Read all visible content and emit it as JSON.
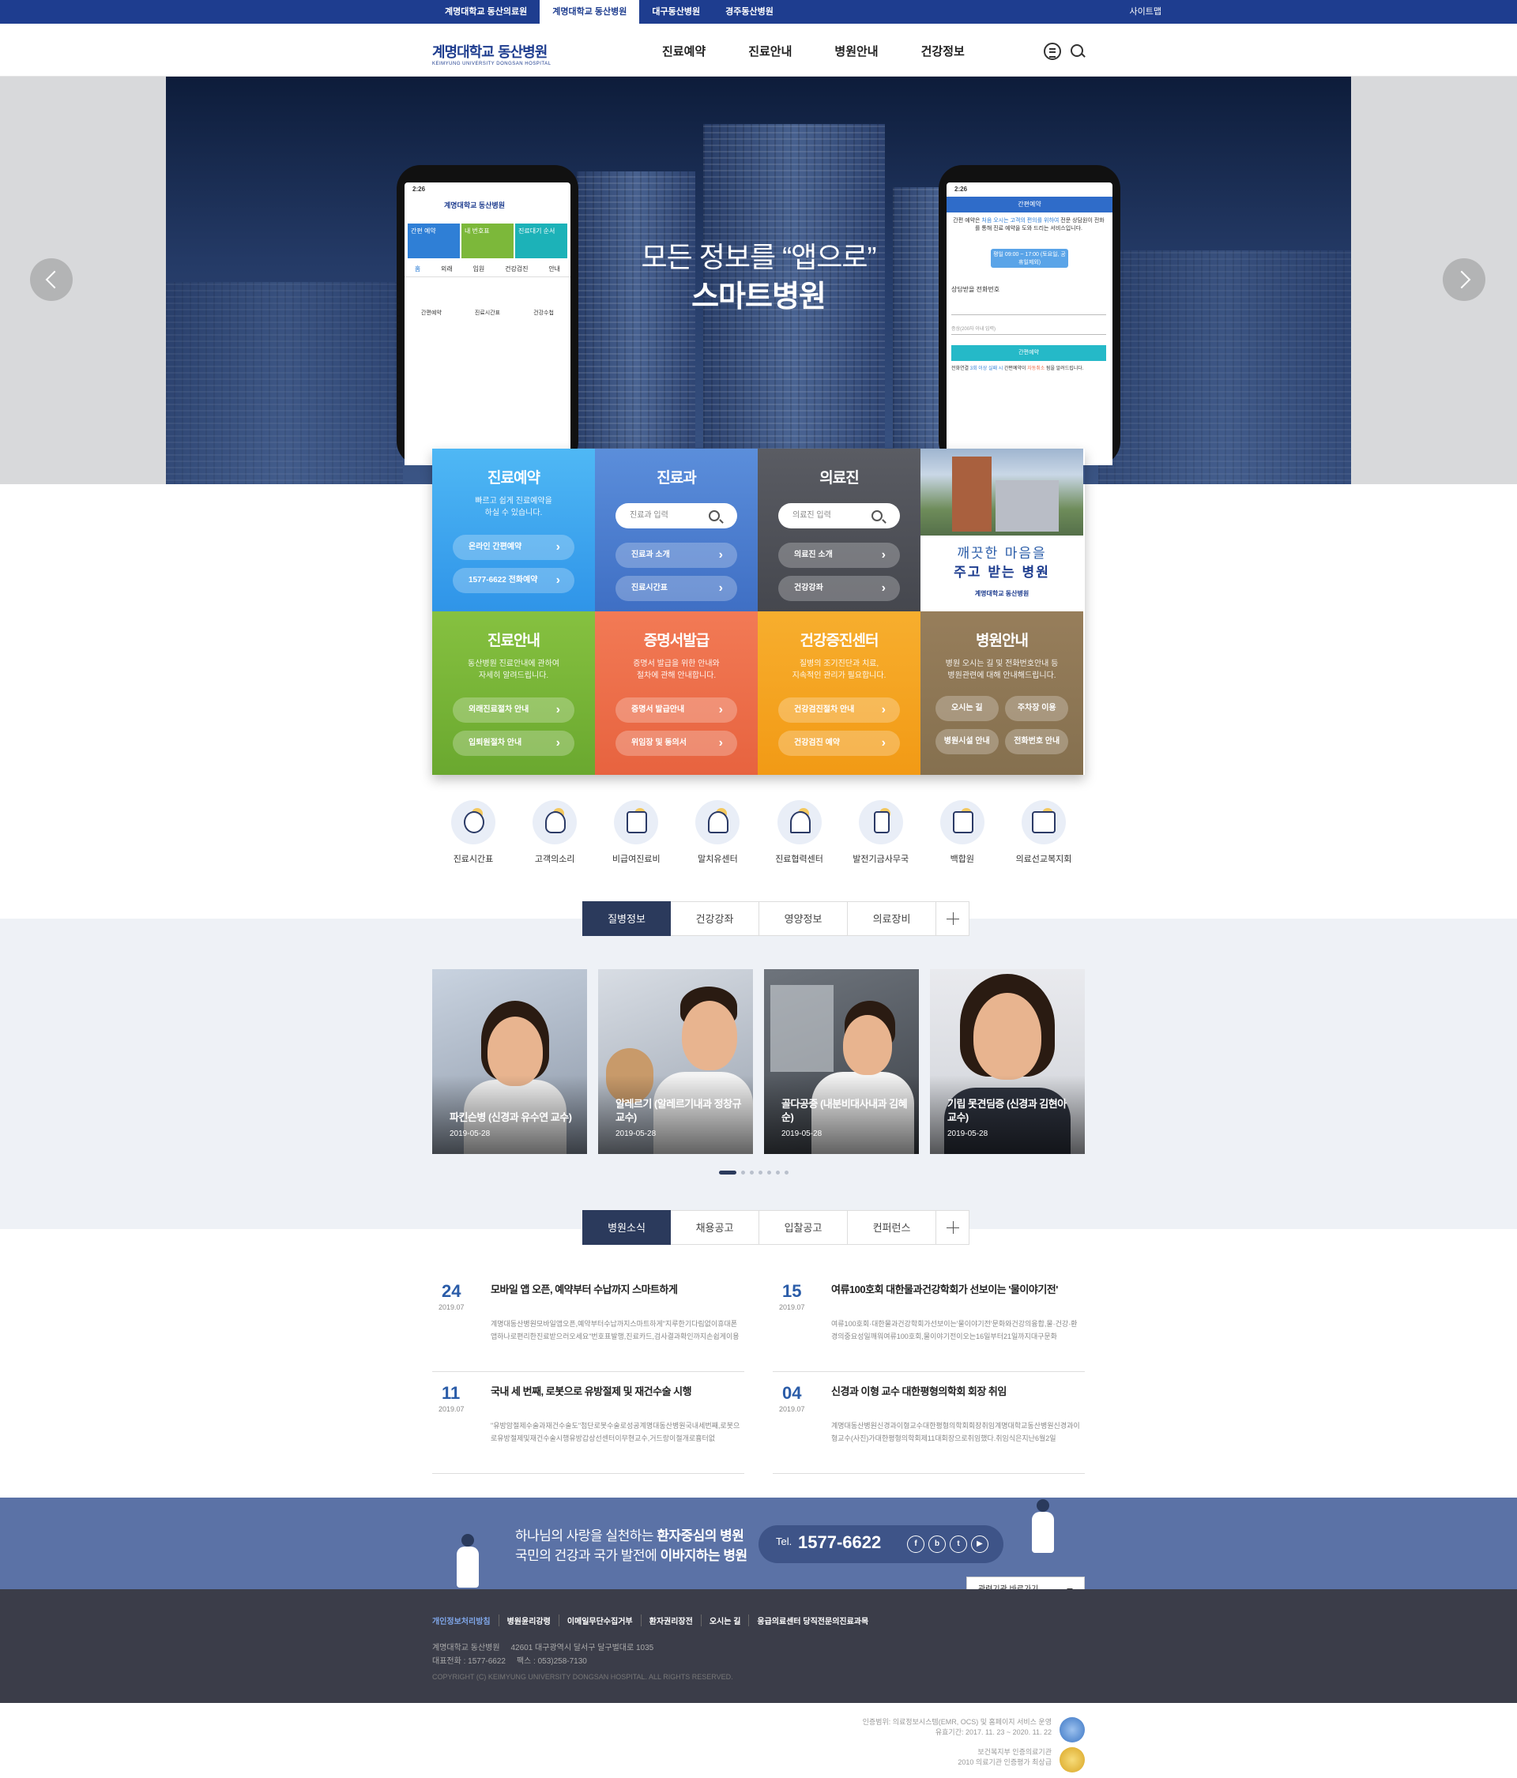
{
  "topbar": {
    "tabs": [
      "계명대학교 동산의료원",
      "계명대학교 동산병원",
      "대구동산병원",
      "경주동산병원"
    ],
    "sitemap": "사이트맵"
  },
  "header": {
    "logo_kr": "계명대학교 동산병원",
    "logo_en": "KEIMYUNG UNIVERSITY DONGSAN HOSPITAL",
    "nav": [
      "진료예약",
      "진료안내",
      "병원안내",
      "건강정보"
    ],
    "icons": [
      "menu-icon",
      "search-icon"
    ]
  },
  "hero": {
    "line1": "모든 정보를 “앱으로”",
    "line2": "스마트병원",
    "phone_left": {
      "time": "2:26",
      "logo": "계명대학교 동산병원",
      "tiles": [
        "간편 예약",
        "내 번호표",
        "진료대기 순서"
      ],
      "tabs": [
        "홈",
        "외래",
        "입원",
        "건강검진",
        "안내"
      ],
      "menu": [
        "간편예약",
        "진료시간표",
        "건강수첩"
      ]
    },
    "phone_right": {
      "time": "2:26",
      "title": "간편예약",
      "desc_1": "간편 예약은",
      "desc_hl": "처음 오시는 고객의 편의를 위하여",
      "desc_2": "전문 상담원이 전화를 통해 진료 예약을 도와 드리는 서비스입니다.",
      "hours": "평일 09:00 ~ 17:00 (토요일, 공휴일제외)",
      "phone_label": "상담받을 전화번호",
      "memo_ph": "증상(200자 이내 입력)",
      "submit": "간편예약",
      "note_1": "전화연결",
      "note_hl1": "3회 이상 실패 시",
      "note_2": "간편예약이",
      "note_hl2": "자동취소",
      "note_3": "됨을 알려드립니다."
    }
  },
  "quick_grid": [
    {
      "title": "진료예약",
      "desc": "빠르고 쉽게 진료예약을\n하실 수 있습니다.",
      "buttons": [
        "온라인 간편예약",
        "1577-6622 전화예약"
      ],
      "color": "#3ea7f0"
    },
    {
      "title": "진료과",
      "search": "진료과 입력",
      "buttons": [
        "진료과 소개",
        "진료시간표"
      ],
      "color": "#4a7fd0"
    },
    {
      "title": "의료진",
      "search": "의료진 입력",
      "buttons": [
        "의료진 소개",
        "건강강좌"
      ],
      "color": "#4f5158"
    },
    {
      "title": "",
      "image_text1": "깨끗한 마음을",
      "image_text2": "주고 받는 병원",
      "image_logo": "계명대학교 동산병원"
    },
    {
      "title": "진료안내",
      "desc": "동산병원 진료안내에 관하여\n자세히 알려드립니다.",
      "buttons": [
        "외래진료절차 안내",
        "입퇴원절차 안내"
      ],
      "color": "#7cb83a"
    },
    {
      "title": "증명서발급",
      "desc": "증명서 발급을 위한 안내와\n절차에 관해 안내합니다.",
      "buttons": [
        "증명서 발급안내",
        "위임장 및 동의서"
      ],
      "color": "#ef6f4c"
    },
    {
      "title": "건강증진센터",
      "desc": "질병의 조기진단과 치료,\n지속적인 관리가 필요합니다.",
      "buttons": [
        "건강검진절차 안내",
        "건강검진 예약"
      ],
      "color": "#f5a623"
    },
    {
      "title": "병원안내",
      "desc": "병원 오시는 길 및 전화번호안내 등\n병원관련에 대해 안내해드립니다.",
      "pills": [
        "오시는 길",
        "주차장 이용",
        "병원시설 안내",
        "전화번호 안내"
      ],
      "color": "#8d7552"
    }
  ],
  "quick_icons": [
    {
      "label": "진료시간표",
      "icon": "lamp-icon"
    },
    {
      "label": "고객의소리",
      "icon": "heart-hand-icon"
    },
    {
      "label": "비급여진료비",
      "icon": "document-icon"
    },
    {
      "label": "말치유센터",
      "icon": "head-gear-icon"
    },
    {
      "label": "진료협력센터",
      "icon": "team-bulb-icon"
    },
    {
      "label": "발전기금사무국",
      "icon": "hourglass-icon"
    },
    {
      "label": "백합원",
      "icon": "frame-icon"
    },
    {
      "label": "의료선교복지회",
      "icon": "building-icon"
    }
  ],
  "disease": {
    "tabs": [
      "질병정보",
      "건강강좌",
      "영양정보",
      "의료장비"
    ],
    "cards": [
      {
        "title": "파킨슨병 (신경과 유수연 교수)",
        "date": "2019-05-28"
      },
      {
        "title": "알레르기 (알레르기내과 정창규 교수)",
        "date": "2019-05-28"
      },
      {
        "title": "골다공증 (내분비대사내과 김혜순)",
        "date": "2019-05-28"
      },
      {
        "title": "기립 못견딤증 (신경과 김현아 교수)",
        "date": "2019-05-28"
      }
    ],
    "page_count": 7,
    "current_page": 1
  },
  "news": {
    "tabs": [
      "병원소식",
      "채용공고",
      "입찰공고",
      "컨퍼런스"
    ],
    "items": [
      {
        "day": "24",
        "ym": "2019.07",
        "title": "모바일 앱 오픈, 예약부터 수납까지 스마트하게",
        "body": "계명대동산병원모바일앱오픈,예약부터수납까지스마트하게\"지루한기다림없이휴대폰앱하나로편리한진료받으러오세요\"번호표발행,진료카드,검사결과확인까지손쉽게이용"
      },
      {
        "day": "15",
        "ym": "2019.07",
        "title": "여류100호회 대한물과건강학회가 선보이는 '물이야기전'",
        "body": "여류100호회·대한물과건강학회가선보이는'물이야기전'문화와건강의융합,물·건강·환경의중요성일깨워여류100호회,물이야기전이오는16일부터21일까지대구문화"
      },
      {
        "day": "11",
        "ym": "2019.07",
        "title": "국내 세 번째, 로봇으로 유방절제 및 재건수술 시행",
        "body": "\"유방암절제수술과재건수술도\"첨단로봇수술로성공계명대동산병원국내세번째,로봇으로유방절제및재건수술시행유방갑상선센터이무현교수,거드랑이절개로흉터없"
      },
      {
        "day": "04",
        "ym": "2019.07",
        "title": "신경과 이형 교수 대한평형의학회 회장 취임",
        "body": "계명대동산병원신경과이형교수대한평형의학회회장취임계명대학교동산병원신경과이형교수(사진)가대한평형의학회제11대회장으로취임했다.취임식은지난6월2일"
      }
    ]
  },
  "band": {
    "line1_a": "하나님의 사랑을 실천하는 ",
    "line1_b": "환자중심의 병원",
    "line2_a": "국민의 건강과 국가 발전에 ",
    "line2_b": "이바지하는 병원",
    "tel_label": "Tel.",
    "tel": "1577-6622",
    "sns": [
      "facebook-icon",
      "blog-icon",
      "twitter-icon",
      "youtube-icon"
    ],
    "related": "관련기관 바로가기"
  },
  "footer": {
    "links": [
      "개인정보처리방침",
      "병원윤리강령",
      "이메일무단수집거부",
      "환자권리장전",
      "오시는 길",
      "응급의료센터 당직전문의진료과목"
    ],
    "addr1": "계명대학교 동산병원     42601 대구광역시 달서구 달구벌대로 1035",
    "addr2": "대표전화 : 1577-6622     팩스 : 053)258-7130",
    "copyright": "COPYRIGHT (C) KEIMYUNG UNIVERSITY DONGSAN HOSPITAL. ALL RIGHTS RESERVED."
  },
  "certs": [
    {
      "line1": "인증범위: 의료정보시스템(EMR, OCS) 및 홈페이지 서비스 운영",
      "line2": "유효기간: 2017. 11. 23 ~ 2020. 11. 22",
      "color": "#3a75c4"
    },
    {
      "line1": "보건복지부 인증의료기관",
      "line2": "2010 의료기관 인증평가 최상급",
      "color": "#d9a523"
    }
  ]
}
